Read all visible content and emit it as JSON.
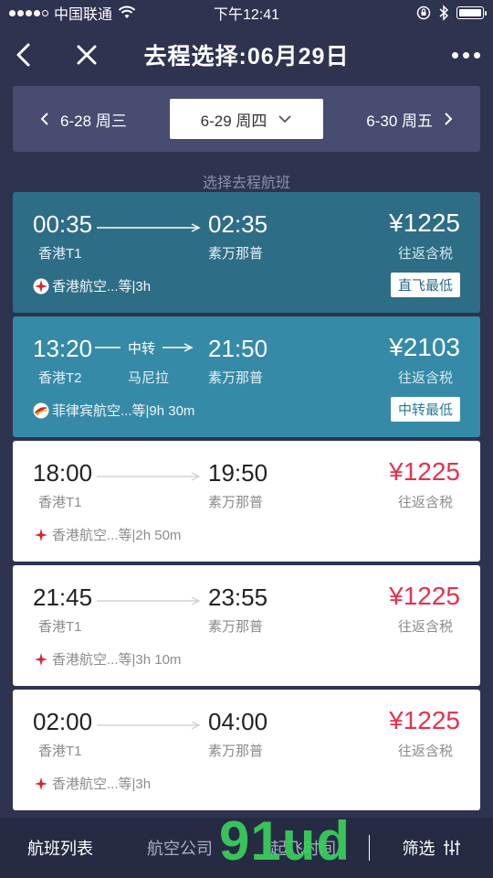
{
  "status": {
    "carrier": "中国联通",
    "time": "下午12:41"
  },
  "nav": {
    "title": "去程选择:06月29日"
  },
  "dates": {
    "prev": "6-28 周三",
    "current": "6-29 周四",
    "next": "6-30 周五"
  },
  "section_label": "选择去程航班",
  "flights": [
    {
      "dep_time": "00:35",
      "arr_time": "02:35",
      "dep_airport": "香港T1",
      "arr_airport": "素万那普",
      "price": "¥1225",
      "price_note": "往返含税",
      "airline": "香港航空...等|3h",
      "badge": "直飞最低"
    },
    {
      "dep_time": "13:20",
      "arr_time": "21:50",
      "dep_airport": "香港T2",
      "arr_airport": "素万那普",
      "transfer_label": "中转",
      "transfer_city": "马尼拉",
      "price": "¥2103",
      "price_note": "往返含税",
      "airline": "菲律宾航空...等|9h 30m",
      "badge": "中转最低"
    },
    {
      "dep_time": "18:00",
      "arr_time": "19:50",
      "dep_airport": "香港T1",
      "arr_airport": "素万那普",
      "price": "¥1225",
      "price_note": "往返含税",
      "airline": "香港航空...等|2h 50m"
    },
    {
      "dep_time": "21:45",
      "arr_time": "23:55",
      "dep_airport": "香港T1",
      "arr_airport": "素万那普",
      "price": "¥1225",
      "price_note": "往返含税",
      "airline": "香港航空...等|3h 10m"
    },
    {
      "dep_time": "02:00",
      "arr_time": "04:00",
      "dep_airport": "香港T1",
      "arr_airport": "素万那普",
      "price": "¥1225",
      "price_note": "往返含税",
      "airline": "香港航空...等|3h"
    }
  ],
  "bottom": {
    "list": "航班列表",
    "airline": "航空公司",
    "time": "起飞时间",
    "filter": "筛选"
  },
  "watermark": "91ud",
  "colors": {
    "background": "#2e3350",
    "card_dark": "#2e6d86",
    "card_teal": "#358aa8",
    "price_red": "#e8304f"
  }
}
